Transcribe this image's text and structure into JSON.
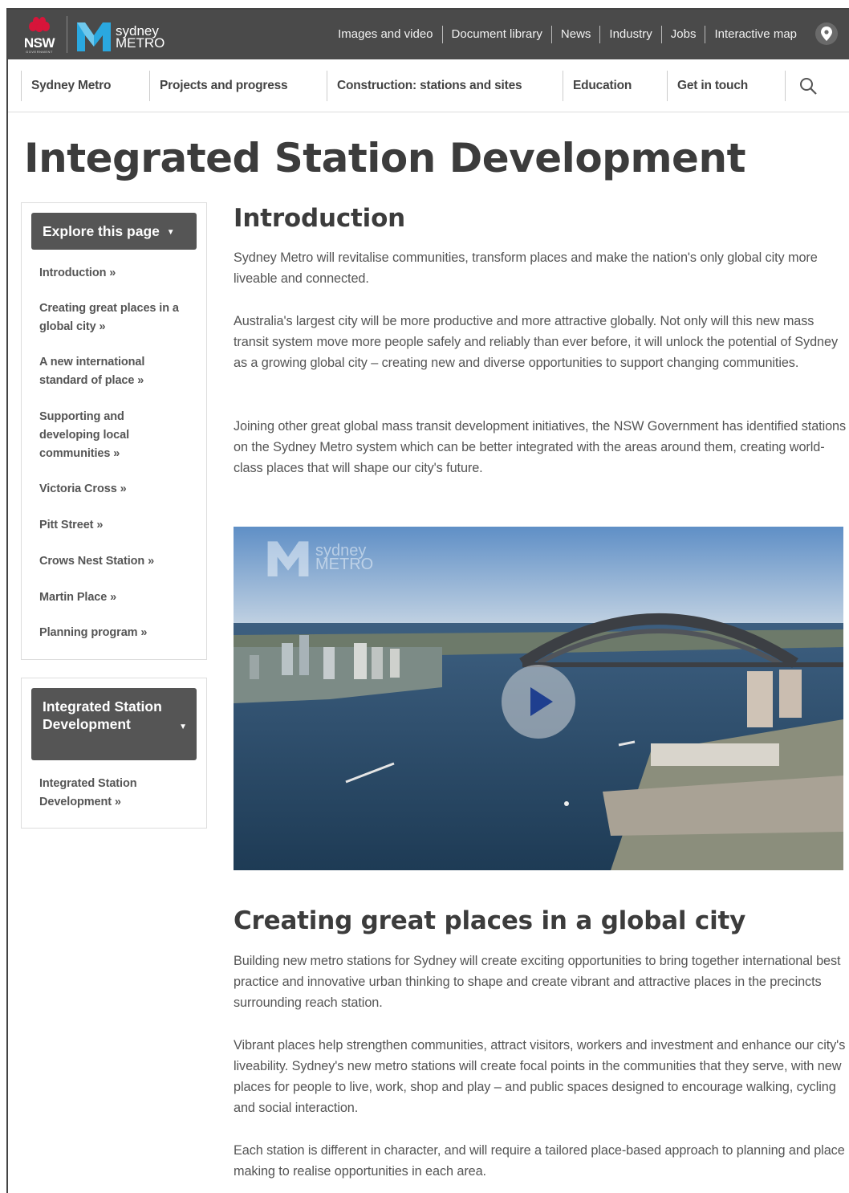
{
  "header": {
    "nsw_label": "NSW",
    "nsw_sub": "GOVERNMENT",
    "brand_line1": "sydney",
    "brand_line2": "METRO",
    "top_links": [
      "Images and video",
      "Document library",
      "News",
      "Industry",
      "Jobs",
      "Interactive map"
    ]
  },
  "nav": {
    "items": [
      "Sydney Metro",
      "Projects and progress",
      "Construction: stations and sites",
      "Education",
      "Get in touch"
    ]
  },
  "page": {
    "title": "Integrated Station Development"
  },
  "sidebar": {
    "explore_title": "Explore this page",
    "explore_links": [
      "Introduction »",
      "Creating great places in a global city »",
      "A new international standard of place »",
      "Supporting and developing local communities »",
      "Victoria Cross »",
      "Pitt Street »",
      "Crows Nest Station »",
      "Martin Place »",
      "Planning program »"
    ],
    "section_title": "Integrated Station Development",
    "section_links": [
      "Integrated Station Development »"
    ]
  },
  "content": {
    "intro_heading": "Introduction",
    "intro_paras": [
      "Sydney Metro will revitalise communities, transform places and make the nation's only global city more liveable and connected.",
      "Australia's largest city will be more productive and more attractive globally. Not only will this new mass transit system move more people safely and reliably than ever before, it will unlock the potential of Sydney as a growing global city – creating new and diverse opportunities to support changing communities.",
      "Joining other great global mass transit development initiatives, the NSW Government has identified stations on the Sydney Metro system which can be better integrated with the areas around them, creating world-class places that will shape our city's future."
    ],
    "video_watermark_line1": "sydney",
    "video_watermark_line2": "METRO",
    "section2_heading": "Creating great places in a global city",
    "section2_paras": [
      "Building new metro stations for Sydney will create exciting opportunities to bring together international best practice and innovative urban thinking to shape and create vibrant and attractive places in the precincts surrounding reach station.",
      "Vibrant places help strengthen communities, attract visitors, workers and investment and enhance our city's liveability. Sydney's new metro stations will create focal points in the communities that they serve, with new places for people to live, work, shop and play – and public spaces designed to encourage walking, cycling and social interaction.",
      "Each station is different in character, and will require a tailored place-based approach to planning and place making to realise opportunities in each area."
    ]
  },
  "colors": {
    "topbar": "#4a4a4a",
    "nsw_red": "#d7153a",
    "metro_blue": "#2aa8e0",
    "sidebar_head": "#555555"
  }
}
